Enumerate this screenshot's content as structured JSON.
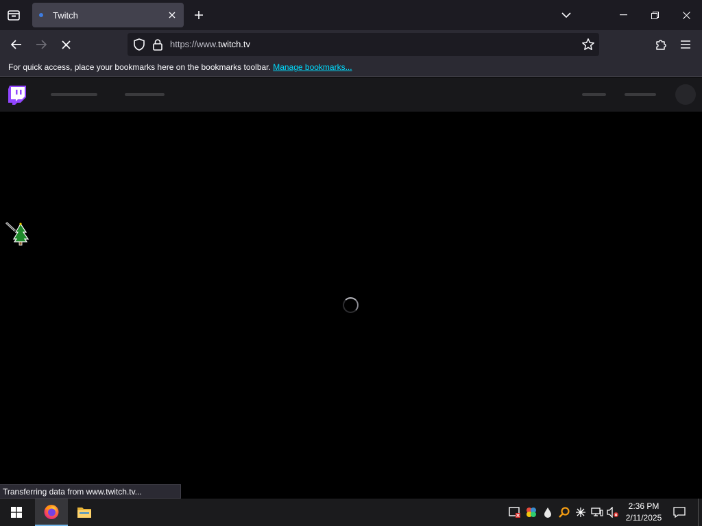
{
  "browser": {
    "tab": {
      "title": "Twitch"
    },
    "url": {
      "prefix": "https://www.",
      "domain": "twitch.tv"
    },
    "bookmarks_bar": {
      "message": "For quick access, place your bookmarks here on the bookmarks toolbar.",
      "link": "Manage bookmarks..."
    },
    "status": "Transferring data from www.twitch.tv...",
    "accent": "#00ddff"
  },
  "page": {
    "brand_color": "#9146ff",
    "loading": true
  },
  "taskbar": {
    "pinned": [
      "firefox-icon",
      "file-explorer-icon"
    ],
    "tray": [
      "security-alert-icon",
      "colorful-app-icon",
      "drop-icon",
      "search-orange-icon",
      "bluetooth-asterisk-icon",
      "network-icon",
      "volume-muted-icon"
    ],
    "time": "2:36 PM",
    "date": "2/11/2025"
  }
}
